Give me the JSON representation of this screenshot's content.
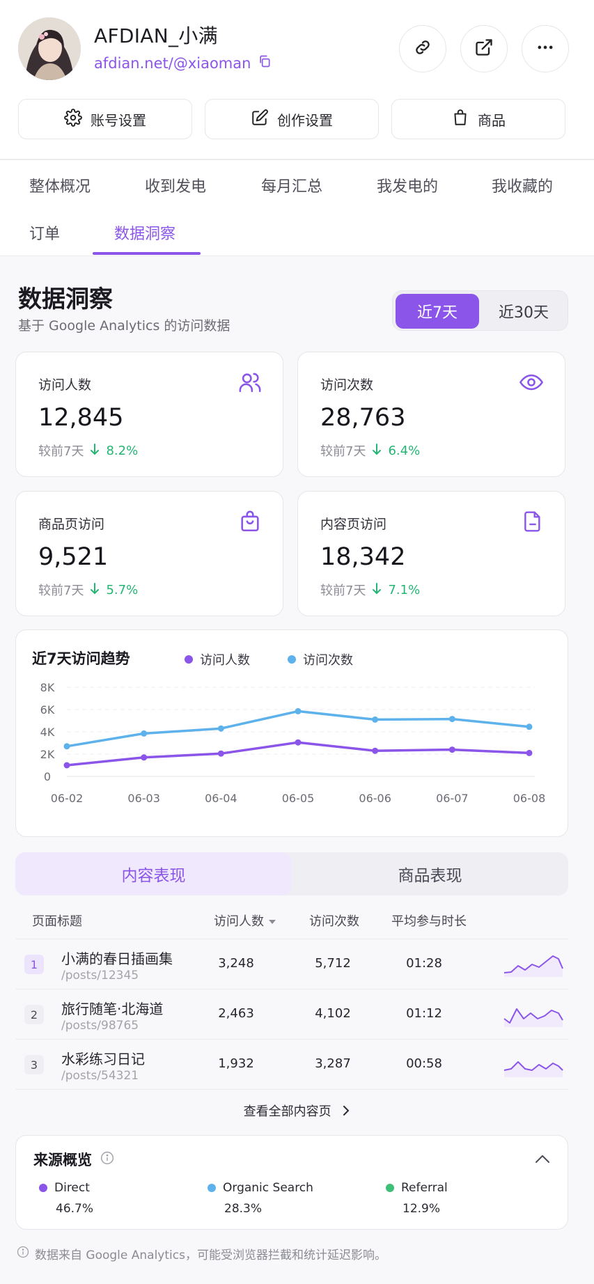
{
  "profile": {
    "name": "AFDIAN_小满",
    "link": "afdian.net/@xiaoman"
  },
  "actions": {
    "account_settings": "账号设置",
    "creation_settings": "创作设置",
    "products": "商品"
  },
  "tabs": [
    "整体概况",
    "收到发电",
    "每月汇总",
    "我发电的",
    "我收藏的",
    "订单",
    "数据洞察"
  ],
  "insights": {
    "title": "数据洞察",
    "subtitle": "基于 Google Analytics 的访问数据",
    "range_options": [
      "近7天",
      "近30天"
    ],
    "selected_range": "近7天"
  },
  "stats": [
    {
      "label": "访问人数",
      "value": "12,845",
      "compare": "较前7天",
      "change": "8.2%",
      "icon": "users-icon"
    },
    {
      "label": "访问次数",
      "value": "28,763",
      "compare": "较前7天",
      "change": "6.4%",
      "icon": "eye-icon"
    },
    {
      "label": "商品页访问",
      "value": "9,521",
      "compare": "较前7天",
      "change": "5.7%",
      "icon": "shopping-bag-icon"
    },
    {
      "label": "内容页访问",
      "value": "18,342",
      "compare": "较前7天",
      "change": "7.1%",
      "icon": "document-icon"
    }
  ],
  "chart_data": {
    "type": "line",
    "title": "近7天访问趋势",
    "x": [
      "06-02",
      "06-03",
      "06-04",
      "06-05",
      "06-06",
      "06-07",
      "06-08"
    ],
    "yticks": [
      "0",
      "2K",
      "4K",
      "6K",
      "8K"
    ],
    "ylim": [
      0,
      8000
    ],
    "grid": true,
    "legend": "top",
    "series": [
      {
        "name": "访问人数",
        "color": "#8a55e8",
        "values": [
          1000,
          1700,
          2050,
          3050,
          2300,
          2400,
          2100
        ]
      },
      {
        "name": "访问次数",
        "color": "#5eb2ec",
        "values": [
          2700,
          3850,
          4300,
          5850,
          5100,
          5150,
          4450
        ]
      }
    ]
  },
  "content_tabs": {
    "active": "内容表现",
    "inactive": "商品表现"
  },
  "table": {
    "headers": [
      "页面标题",
      "访问人数",
      "访问次数",
      "平均参与时长"
    ],
    "rows": [
      {
        "rank": "1",
        "title": "小满的春日插画集",
        "path": "/posts/12345",
        "visitors": "3,248",
        "visits": "5,712",
        "duration": "01:28"
      },
      {
        "rank": "2",
        "title": "旅行随笔·北海道",
        "path": "/posts/98765",
        "visitors": "2,463",
        "visits": "4,102",
        "duration": "01:12"
      },
      {
        "rank": "3",
        "title": "水彩练习日记",
        "path": "/posts/54321",
        "visitors": "1,932",
        "visits": "3,287",
        "duration": "00:58"
      }
    ],
    "view_all": "查看全部内容页"
  },
  "sources": {
    "title": "来源概览",
    "items": [
      {
        "name": "Direct",
        "value": "46.7%",
        "color": "#8a55e8"
      },
      {
        "name": "Organic Search",
        "value": "28.3%",
        "color": "#5eb2ec"
      },
      {
        "name": "Referral",
        "value": "12.9%",
        "color": "#3dbf7a"
      }
    ]
  },
  "footnote": "数据来自 Google Analytics，可能受浏览器拦截和统计延迟影响。",
  "colors": {
    "accent": "#8a55e8",
    "positive": "#22b573",
    "secondary": "#5eb2ec"
  }
}
